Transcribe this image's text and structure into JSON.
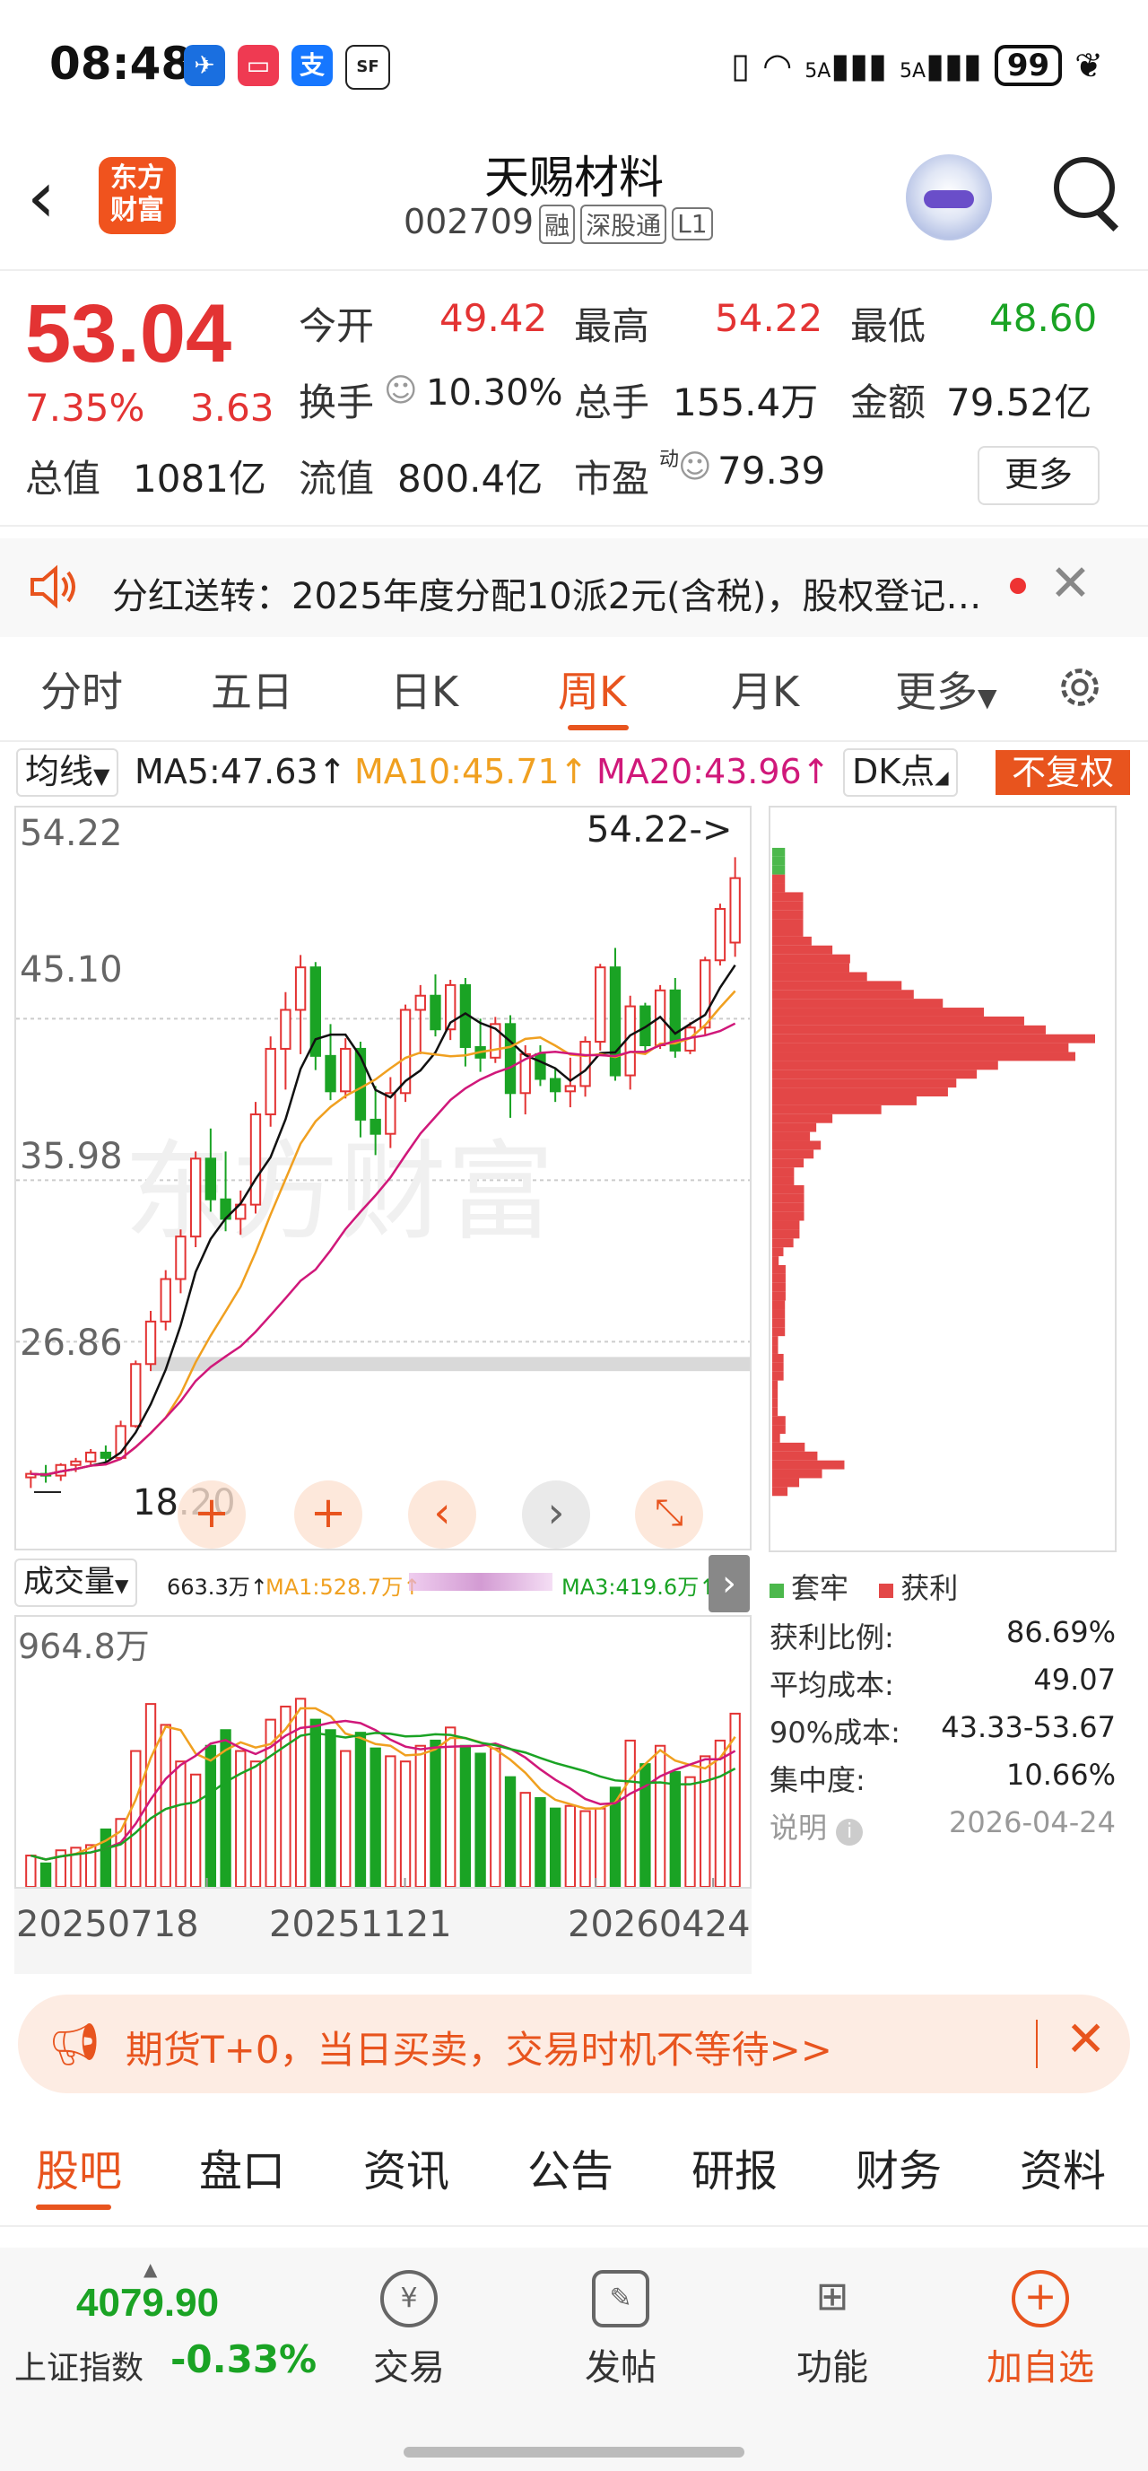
{
  "status_bar": {
    "time": "08:48",
    "battery": "99",
    "signal1": "5A",
    "signal2": "5A",
    "app_icons": [
      "plane-app-icon",
      "red-app-icon",
      "alipay-icon",
      "sf-express-icon"
    ],
    "alipay_char": "支",
    "sf_label": "SF"
  },
  "header": {
    "logo_line1": "东方",
    "logo_line2": "财富",
    "title": "天赐材料",
    "code": "002709",
    "tags": [
      "融",
      "深股通",
      "L1"
    ]
  },
  "quote": {
    "price": "53.04",
    "change_pct": "7.35%",
    "change": "3.63",
    "open_label": "今开",
    "open": "49.42",
    "high_label": "最高",
    "high": "54.22",
    "low_label": "最低",
    "low": "48.60",
    "turnover_label": "换手",
    "turnover": "10.30%",
    "volume_label": "总手",
    "volume": "155.4万",
    "amount_label": "金额",
    "amount": "79.52亿",
    "mktcap_label": "总值",
    "mktcap": "1081亿",
    "float_label": "流值",
    "float_cap": "800.4亿",
    "pe_label": "市盈",
    "pe_sup": "动",
    "pe": "79.39",
    "more_label": "更多"
  },
  "notice": {
    "text": "分红送转：2025年度分配10派2元(含税)，股权登记…"
  },
  "tabs": {
    "items": [
      "分时",
      "五日",
      "日K",
      "周K",
      "月K",
      "更多"
    ],
    "active": "周K"
  },
  "ma_bar": {
    "select_label": "均线",
    "ma5": "MA5:47.63",
    "ma10": "MA10:45.71",
    "ma20": "MA20:43.96",
    "dk_label": "DK点",
    "adjust_label": "不复权"
  },
  "colors": {
    "up": "#e33333",
    "down": "#1aa324",
    "accent": "#e8541e",
    "ma5": "#111111",
    "ma10": "#f0a020",
    "ma20": "#d0187a"
  },
  "chart_data": {
    "type": "candlestick",
    "y_ticks": [
      "54.22",
      "45.10",
      "35.98",
      "26.86"
    ],
    "max_label": "54.22->",
    "min_label": "18.20",
    "x_labels": [
      "20250718",
      "20251121",
      "20260424"
    ],
    "ylim": [
      17,
      55
    ],
    "candles": [
      [
        19.2,
        19.6,
        18.6,
        19.4
      ],
      [
        19.4,
        19.9,
        18.9,
        19.3
      ],
      [
        19.3,
        20.0,
        19.0,
        19.9
      ],
      [
        19.9,
        20.3,
        19.5,
        20.1
      ],
      [
        20.1,
        20.8,
        19.9,
        20.6
      ],
      [
        20.6,
        21.0,
        20.0,
        20.3
      ],
      [
        20.3,
        22.4,
        20.2,
        22.1
      ],
      [
        22.1,
        25.8,
        22.0,
        25.6
      ],
      [
        25.6,
        28.6,
        25.2,
        28.0
      ],
      [
        28.0,
        30.9,
        27.5,
        30.4
      ],
      [
        30.4,
        33.2,
        29.6,
        32.8
      ],
      [
        32.8,
        37.6,
        32.2,
        37.2
      ],
      [
        37.2,
        38.9,
        34.2,
        34.9
      ],
      [
        34.9,
        37.6,
        33.1,
        33.8
      ],
      [
        33.8,
        35.4,
        32.9,
        34.6
      ],
      [
        34.6,
        40.4,
        34.1,
        39.7
      ],
      [
        39.7,
        44.1,
        39.0,
        43.4
      ],
      [
        43.4,
        46.6,
        41.1,
        45.6
      ],
      [
        45.6,
        48.7,
        43.1,
        48.0
      ],
      [
        48.0,
        48.3,
        42.2,
        43.0
      ],
      [
        43.0,
        44.8,
        40.5,
        41.0
      ],
      [
        41.0,
        44.0,
        40.6,
        43.4
      ],
      [
        43.4,
        43.8,
        38.4,
        39.4
      ],
      [
        39.4,
        41.3,
        37.4,
        38.6
      ],
      [
        38.6,
        41.8,
        37.8,
        40.9
      ],
      [
        40.9,
        45.9,
        40.4,
        45.6
      ],
      [
        45.6,
        47.0,
        43.1,
        46.4
      ],
      [
        46.4,
        47.6,
        44.1,
        44.5
      ],
      [
        44.5,
        47.3,
        43.9,
        47.0
      ],
      [
        47.0,
        47.4,
        42.4,
        43.5
      ],
      [
        43.5,
        45.1,
        42.1,
        42.9
      ],
      [
        42.9,
        45.2,
        42.6,
        44.8
      ],
      [
        44.8,
        45.3,
        39.5,
        40.9
      ],
      [
        40.9,
        43.6,
        39.7,
        43.1
      ],
      [
        43.1,
        43.6,
        41.3,
        41.7
      ],
      [
        41.7,
        42.3,
        40.4,
        41.0
      ],
      [
        41.0,
        42.9,
        40.1,
        41.3
      ],
      [
        41.3,
        44.1,
        40.7,
        43.8
      ],
      [
        43.8,
        48.2,
        43.3,
        48.0
      ],
      [
        48.0,
        49.1,
        41.6,
        41.9
      ],
      [
        41.9,
        46.4,
        41.1,
        45.8
      ],
      [
        45.8,
        46.0,
        43.3,
        43.6
      ],
      [
        43.6,
        47.0,
        43.4,
        46.7
      ],
      [
        46.7,
        47.4,
        42.9,
        43.3
      ],
      [
        43.3,
        44.9,
        43.1,
        44.6
      ],
      [
        44.6,
        48.6,
        44.2,
        48.4
      ],
      [
        48.4,
        51.6,
        48.1,
        51.3
      ],
      [
        49.4,
        54.22,
        48.6,
        53.04
      ]
    ]
  },
  "distribution": {
    "legend_trapped": "套牢",
    "legend_profit": "获利",
    "stats": [
      {
        "label": "获利比例:",
        "value": "86.69%"
      },
      {
        "label": "平均成本:",
        "value": "49.07"
      },
      {
        "label": "90%成本:",
        "value": "43.33-53.67"
      },
      {
        "label": "集中度:",
        "value": "10.66%"
      },
      {
        "label": "说明",
        "value": "2026-04-24"
      }
    ]
  },
  "volume": {
    "select_label": "成交量",
    "vol": "663.3万",
    "ma1": "MA1:528.7万",
    "ma3": "MA3:419.6万",
    "max_label": "964.8万",
    "values_wan": [
      120,
      90,
      140,
      150,
      160,
      220,
      260,
      520,
      700,
      620,
      480,
      430,
      540,
      600,
      520,
      480,
      640,
      690,
      720,
      640,
      600,
      520,
      590,
      530,
      500,
      480,
      540,
      560,
      610,
      540,
      510,
      530,
      420,
      360,
      340,
      300,
      310,
      290,
      300,
      380,
      560,
      470,
      540,
      440,
      420,
      500,
      560,
      663
    ]
  },
  "ad": {
    "text": "期货T+0，当日买卖，交易时机不等待>>"
  },
  "bottom_tabs": {
    "items": [
      "股吧",
      "盘口",
      "资讯",
      "公告",
      "研报",
      "财务",
      "资料"
    ],
    "active": "股吧"
  },
  "footer": {
    "index_value": "4079.90",
    "index_name": "上证指数",
    "index_pct": "-0.33%",
    "trade_label": "交易",
    "post_label": "发帖",
    "func_label": "功能",
    "watch_label": "加自选",
    "trade_icon_text": "¥"
  }
}
